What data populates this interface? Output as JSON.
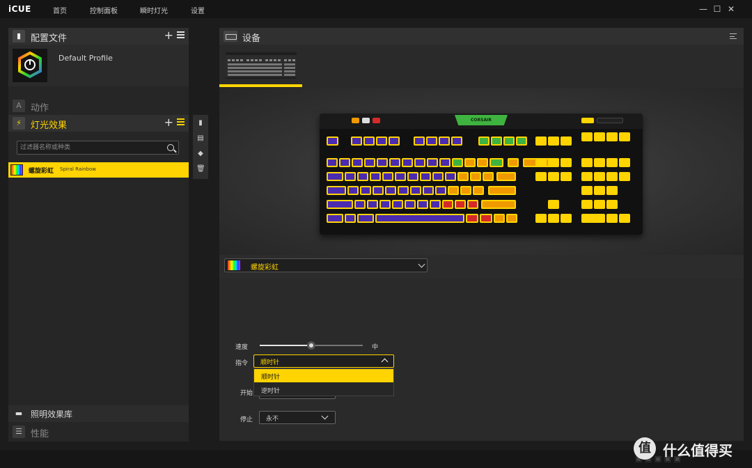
{
  "app": {
    "name": "iCUE"
  },
  "nav": {
    "items": [
      "首页",
      "控制面板",
      "瞬时灯光",
      "设置"
    ]
  },
  "window": {
    "minimize": "—",
    "maximize": "☐",
    "close": "✕"
  },
  "left": {
    "profiles_title": "配置文件",
    "profile_name": "Default Profile",
    "actions_title": "动作",
    "lighting_title": "灯光效果",
    "filter_placeholder": "过滤器名称或种类",
    "effect_name": "螺旋彩虹",
    "effect_sub": "Spiral Rainbow",
    "library_title": "照明效果库",
    "performance_title": "性能"
  },
  "right": {
    "devices_title": "设备",
    "selected_effect": "螺旋彩虹",
    "speed_label": "速度",
    "speed_value_label": "中",
    "speed_level": 0.5,
    "direction_label": "指令",
    "direction_value": "顺时针",
    "direction_options": [
      "顺时针",
      "逆时针"
    ],
    "start_label": "开始",
    "stop_label": "停止",
    "stop_value": "永不"
  },
  "watermark": {
    "text": "什么值得买",
    "mark": "值"
  },
  "colors": {
    "accent": "#ffd400",
    "purple": "#4b2bb0",
    "green": "#3fb33f",
    "orange": "#f09a00",
    "red": "#d42a2a"
  },
  "icons": [
    "profile-icon",
    "plus-icon",
    "menu-icon",
    "actions-icon",
    "lightning-icon",
    "search-icon",
    "copy-icon",
    "keyboard-icon",
    "move-icon",
    "trash-icon",
    "library-icon",
    "performance-icon",
    "chevron-down-icon",
    "chevron-up-icon"
  ]
}
